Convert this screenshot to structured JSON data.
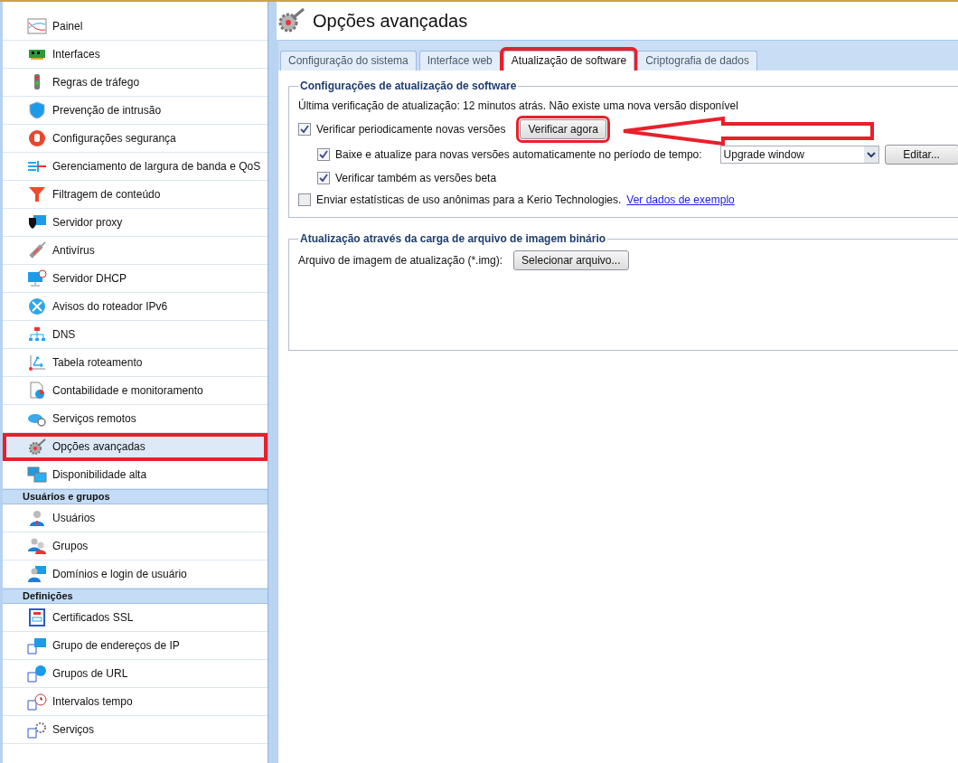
{
  "sidebar": {
    "groups": [
      {
        "items": [
          {
            "label": "Painel",
            "selected": false,
            "highlighted": false
          },
          {
            "label": "Interfaces",
            "selected": false,
            "highlighted": false
          },
          {
            "label": "Regras de tráfego",
            "selected": false,
            "highlighted": false
          },
          {
            "label": "Prevenção de intrusão",
            "selected": false,
            "highlighted": false
          },
          {
            "label": "Configurações segurança",
            "selected": false,
            "highlighted": false
          },
          {
            "label": "Gerenciamento de largura de banda e QoS",
            "selected": false,
            "highlighted": false
          },
          {
            "label": "Filtragem de conteúdo",
            "selected": false,
            "highlighted": false
          },
          {
            "label": "Servidor proxy",
            "selected": false,
            "highlighted": false
          },
          {
            "label": "Antivírus",
            "selected": false,
            "highlighted": false
          },
          {
            "label": "Servidor DHCP",
            "selected": false,
            "highlighted": false
          },
          {
            "label": "Avisos do roteador IPv6",
            "selected": false,
            "highlighted": false
          },
          {
            "label": "DNS",
            "selected": false,
            "highlighted": false
          },
          {
            "label": "Tabela roteamento",
            "selected": false,
            "highlighted": false
          },
          {
            "label": "Contabilidade e monitoramento",
            "selected": false,
            "highlighted": false
          },
          {
            "label": "Serviços remotos",
            "selected": false,
            "highlighted": false
          },
          {
            "label": "Opções avançadas",
            "selected": true,
            "highlighted": true
          },
          {
            "label": "Disponibilidade alta",
            "selected": false,
            "highlighted": false
          }
        ]
      },
      {
        "title": "Usuários e grupos",
        "items": [
          {
            "label": "Usuários",
            "selected": false,
            "highlighted": false
          },
          {
            "label": "Grupos",
            "selected": false,
            "highlighted": false
          },
          {
            "label": "Domínios e login de usuário",
            "selected": false,
            "highlighted": false
          }
        ]
      },
      {
        "title": "Definições",
        "items": [
          {
            "label": "Certificados SSL",
            "selected": false,
            "highlighted": false
          },
          {
            "label": "Grupo de endereços de IP",
            "selected": false,
            "highlighted": false
          },
          {
            "label": "Grupos de URL",
            "selected": false,
            "highlighted": false
          },
          {
            "label": "Intervalos tempo",
            "selected": false,
            "highlighted": false
          },
          {
            "label": "Serviços",
            "selected": false,
            "highlighted": false
          }
        ]
      }
    ]
  },
  "page": {
    "title": "Opções avançadas"
  },
  "tabs": [
    {
      "label": "Configuração do sistema",
      "selected": false,
      "highlighted": false
    },
    {
      "label": "Interface web",
      "selected": false,
      "highlighted": false
    },
    {
      "label": "Atualização de software",
      "selected": true,
      "highlighted": true
    },
    {
      "label": "Criptografia de dados",
      "selected": false,
      "highlighted": false
    }
  ],
  "update_settings": {
    "legend": "Configurações de atualização de software",
    "status": "Última verificação de atualização: 12 minutos atrás. Não existe uma nova versão disponível",
    "periodic": {
      "label": "Verificar periodicamente novas versões",
      "checked": true
    },
    "check_now": {
      "label": "Verificar agora",
      "highlighted": true
    },
    "auto_download": {
      "label": "Baixe e atualize para novas versões automaticamente no período de tempo:",
      "checked": true
    },
    "window_select": {
      "value": "Upgrade window"
    },
    "edit_button": {
      "label": "Editar..."
    },
    "beta": {
      "label": "Verificar também as versões beta",
      "checked": true
    },
    "stats": {
      "label": "Enviar estatísticas de uso anônimas para a Kerio Technologies.",
      "checked": false
    },
    "sample_link": "Ver dados de exemplo"
  },
  "binary_upload": {
    "legend": "Atualização através da carga de arquivo de imagem binário",
    "label": "Arquivo de imagem de atualização (*.img):",
    "button": "Selecionar arquivo..."
  },
  "annotation": {
    "arrow": true
  }
}
